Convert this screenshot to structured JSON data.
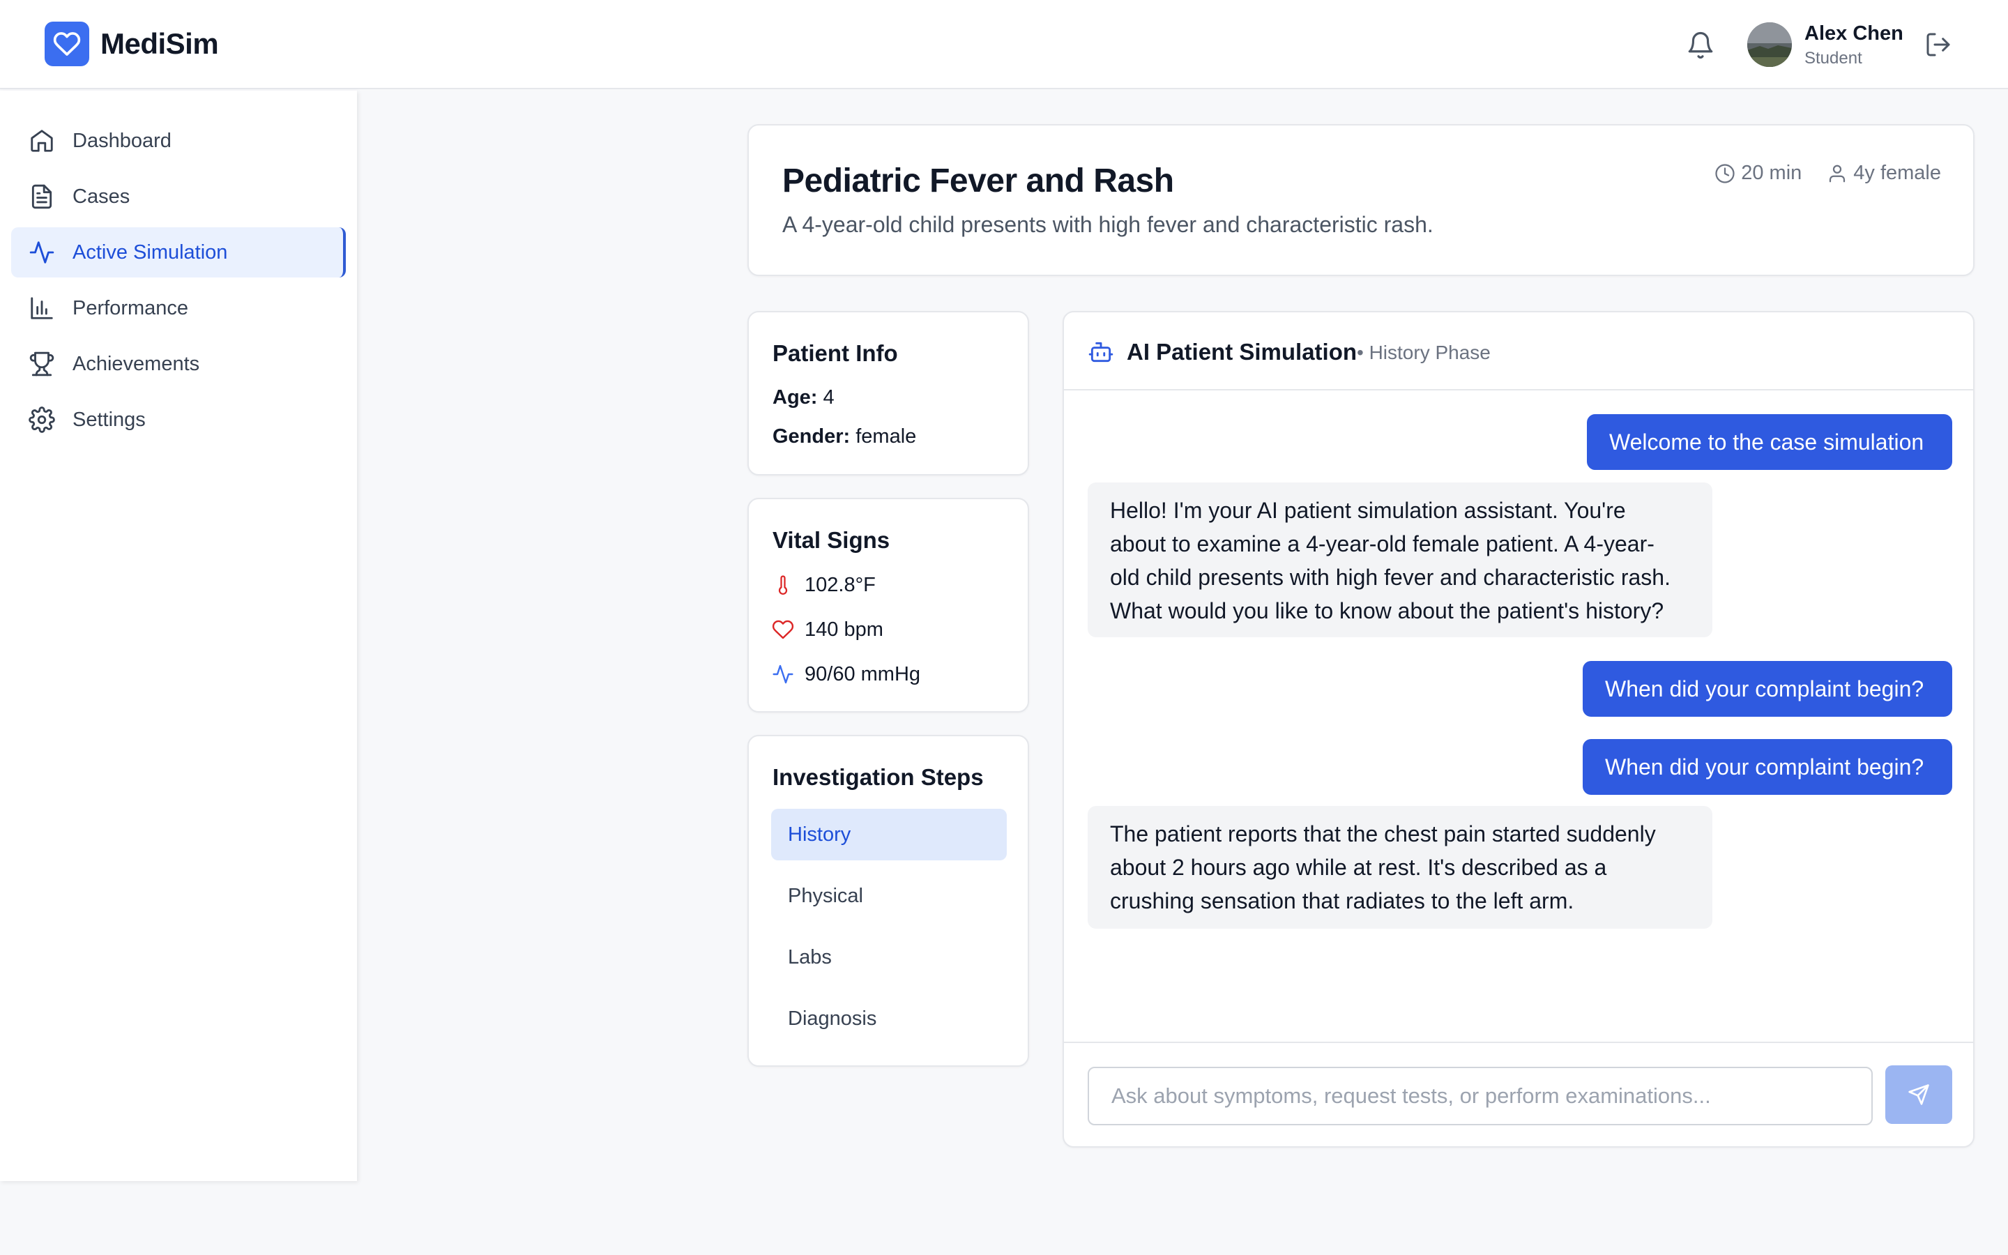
{
  "app": {
    "name": "MediSim"
  },
  "header": {
    "user": {
      "name": "Alex Chen",
      "role": "Student"
    }
  },
  "sidebar": {
    "items": [
      {
        "label": "Dashboard",
        "icon": "home-icon"
      },
      {
        "label": "Cases",
        "icon": "document-icon"
      },
      {
        "label": "Active Simulation",
        "icon": "activity-icon",
        "active": true
      },
      {
        "label": "Performance",
        "icon": "bar-chart-icon"
      },
      {
        "label": "Achievements",
        "icon": "trophy-icon"
      },
      {
        "label": "Settings",
        "icon": "gear-icon"
      }
    ]
  },
  "case": {
    "title": "Pediatric Fever and Rash",
    "description": "A 4-year-old child presents with high fever and characteristic rash.",
    "duration": "20 min",
    "patient_summary": "4y female"
  },
  "patient_info": {
    "title": "Patient Info",
    "age_label": "Age:",
    "age_value": "4",
    "gender_label": "Gender:",
    "gender_value": "female"
  },
  "vitals": {
    "title": "Vital Signs",
    "temperature": "102.8°F",
    "heart_rate": "140 bpm",
    "blood_pressure": "90/60 mmHg"
  },
  "steps": {
    "title": "Investigation Steps",
    "items": [
      "History",
      "Physical",
      "Labs",
      "Diagnosis"
    ],
    "active": "History"
  },
  "chat": {
    "title": "AI Patient Simulation",
    "phase": "• History Phase",
    "messages": [
      {
        "role": "user",
        "text": "Welcome to the case simulation"
      },
      {
        "role": "ai",
        "lines": [
          "Hello! I'm your AI patient simulation assistant. You're",
          "about to examine a 4-year-old female patient. A 4-year-",
          "old child presents with high fever and characteristic rash.",
          "What would you like to know about the patient's history?"
        ]
      },
      {
        "role": "user",
        "text": "When did your complaint begin?"
      },
      {
        "role": "user",
        "text": "When did your complaint begin?"
      },
      {
        "role": "ai",
        "lines": [
          "The patient reports that the chest pain started suddenly",
          "about 2 hours ago while at rest. It's described as a",
          "crushing sensation that radiates to the left arm."
        ]
      }
    ],
    "input_placeholder": "Ask about symptoms, request tests, or perform examinations...",
    "input_value": ""
  },
  "colors": {
    "accent": "#2f5ae0",
    "logo": "#3b6ef0",
    "active_nav_bg": "#eaf1fe",
    "temperature_icon": "#dc2626",
    "heart_icon": "#dc2626",
    "bp_icon": "#3b6ef0",
    "send_button": "#9bb5f2"
  }
}
